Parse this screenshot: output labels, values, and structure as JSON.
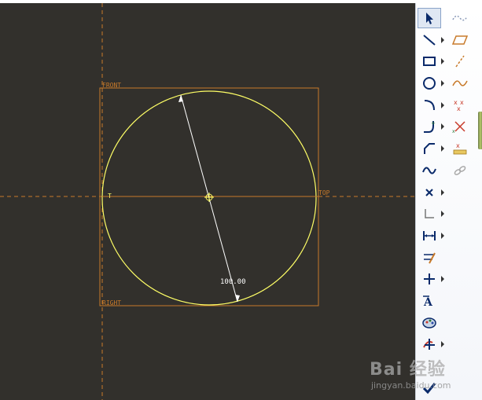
{
  "canvas": {
    "labels": {
      "front": "FRONT",
      "top": "TOP",
      "right": "RIGHT",
      "t_marker": "T"
    },
    "dimension_value": "100.00",
    "colors": {
      "background": "#32302c",
      "datum": "#c87a2a",
      "sketch": "#ffff66",
      "dimension": "#ffffff"
    }
  },
  "toolbar": {
    "left_tools": [
      {
        "name": "select-tool",
        "icon": "pointer-icon"
      },
      {
        "name": "line-tool",
        "icon": "line-icon"
      },
      {
        "name": "rectangle-tool",
        "icon": "rectangle-icon"
      },
      {
        "name": "circle-tool",
        "icon": "circle-icon"
      },
      {
        "name": "arc-tool",
        "icon": "arc-icon"
      },
      {
        "name": "fillet-tool",
        "icon": "fillet-icon"
      },
      {
        "name": "chamfer-tool",
        "icon": "chamfer-icon"
      },
      {
        "name": "spline-tool",
        "icon": "spline-icon"
      },
      {
        "name": "point-tool",
        "icon": "point-icon"
      },
      {
        "name": "coordinate-system-tool",
        "icon": "coordinate-icon"
      },
      {
        "name": "dimension-tool",
        "icon": "dimension-icon"
      },
      {
        "name": "modify-tool",
        "icon": "modify-icon"
      },
      {
        "name": "constraint-tool",
        "icon": "constraint-icon"
      },
      {
        "name": "text-tool",
        "icon": "text-icon"
      },
      {
        "name": "palette-tool",
        "icon": "palette-icon"
      },
      {
        "name": "trim-tool",
        "icon": "trim-icon"
      },
      {
        "name": "mirror-tool",
        "icon": "mirror-icon"
      },
      {
        "name": "done-tool",
        "icon": "checkmark-icon"
      }
    ],
    "right_tools": [
      {
        "name": "blend-tool",
        "icon": "wave-dashed-icon"
      },
      {
        "name": "parallelogram-tool",
        "icon": "parallelogram-icon"
      },
      {
        "name": "centerline-tool",
        "icon": "dashed-line-icon"
      },
      {
        "name": "curve-tool",
        "icon": "curve-icon"
      },
      {
        "name": "point-cross-tool",
        "icon": "cross-points-icon"
      },
      {
        "name": "point-cross-tool-2",
        "icon": "cross-points-icon"
      },
      {
        "name": "point-grid-tool",
        "icon": "point-grid-icon"
      },
      {
        "name": "chain-tool",
        "icon": "chain-icon"
      }
    ]
  },
  "watermark": {
    "logo": "Bai 经验",
    "url": "jingyan.baidu.com"
  }
}
